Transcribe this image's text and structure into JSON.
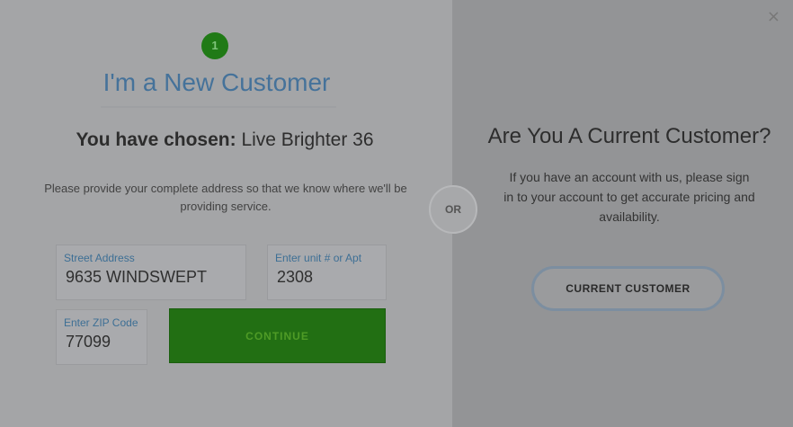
{
  "modal": {
    "close_label": "×"
  },
  "new_customer": {
    "step_number": "1",
    "title": "I'm a New Customer",
    "chosen_prefix": "You have chosen:",
    "chosen_plan": "Live Brighter 36",
    "description": "Please provide your complete address so that we know where we'll be providing service.",
    "street_label": "Street Address",
    "street_value": "9635 WINDSWEPT",
    "unit_label": "Enter unit # or Apt",
    "unit_value": "2308",
    "zip_label": "Enter ZIP Code",
    "zip_value": "77099",
    "continue_label": "CONTINUE"
  },
  "divider": {
    "or_label": "OR"
  },
  "current_customer": {
    "title": "Are You A Current Customer?",
    "description": "If you have an account with us, please sign in to your account to get accurate pricing and availability.",
    "button_label": "CURRENT CUSTOMER"
  }
}
